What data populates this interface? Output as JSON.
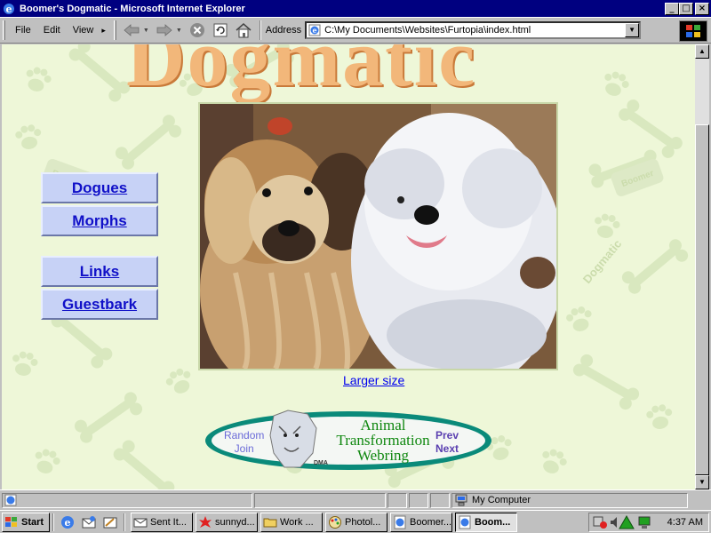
{
  "window": {
    "title": "Boomer's Dogmatic - Microsoft Internet Explorer",
    "controls": {
      "minimize": "_",
      "maximize": "□",
      "close": "×"
    }
  },
  "toolbar": {
    "menus": [
      "File",
      "Edit",
      "View"
    ],
    "menu_overflow": "▸",
    "address_label": "Address",
    "address_value": "C:\\My Documents\\Websites\\Furtopia\\index.html"
  },
  "page": {
    "logo_text": "Dogmatic",
    "nav": [
      {
        "label": "Dogues"
      },
      {
        "label": "Morphs"
      },
      {
        "label": "Links"
      },
      {
        "label": "Guestbark"
      }
    ],
    "larger_link": "Larger size",
    "webring": {
      "random": "Random",
      "join": "Join",
      "title_lines": [
        "Animal",
        "Transformation",
        "Webring"
      ],
      "prev": "Prev",
      "next": "Next",
      "badge": "DMA"
    },
    "bg_watermark": "Boomer",
    "bg_watermark2": "Dogmatic"
  },
  "statusbar": {
    "zone": "My Computer"
  },
  "taskbar": {
    "start_label": "Start",
    "tasks": [
      {
        "label": "Sent It...",
        "icon": "envelope-icon"
      },
      {
        "label": "sunnyd...",
        "icon": "splat-icon"
      },
      {
        "label": "Work ...",
        "icon": "folder-icon"
      },
      {
        "label": "Photol...",
        "icon": "paint-icon"
      },
      {
        "label": "Boomer...",
        "icon": "ie-page-icon"
      },
      {
        "label": "Boom...",
        "icon": "ie-page-icon",
        "active": true
      }
    ],
    "clock": "4:37 AM"
  },
  "colors": {
    "page_bg": "#eef7d8",
    "nav_bg": "#c7d2f6",
    "link": "#1010c8",
    "titlebar": "#000080"
  }
}
